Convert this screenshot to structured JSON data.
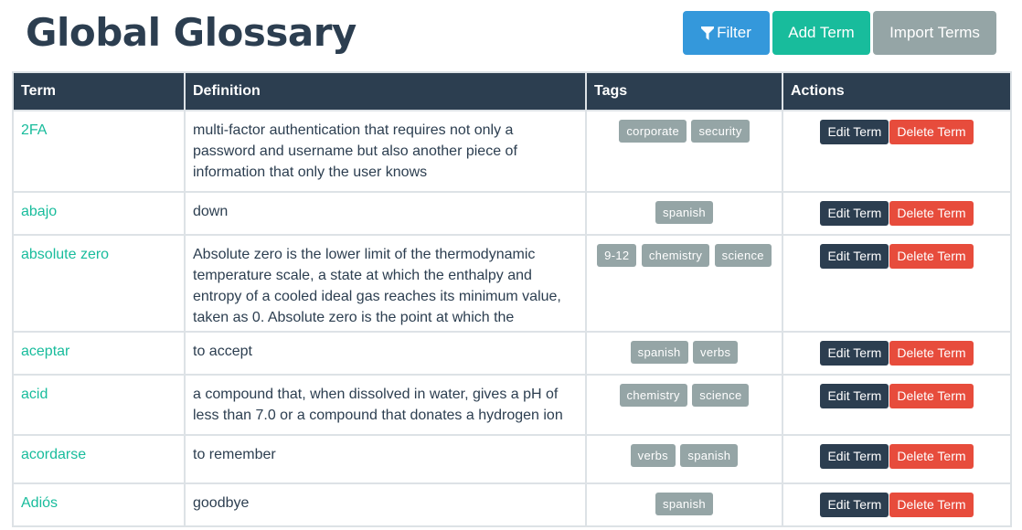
{
  "header": {
    "title": "Global Glossary",
    "buttons": {
      "filter": "Filter",
      "add": "Add Term",
      "import": "Import Terms"
    }
  },
  "table": {
    "columns": [
      "Term",
      "Definition",
      "Tags",
      "Actions"
    ],
    "action_labels": {
      "edit": "Edit Term",
      "delete": "Delete Term"
    },
    "rows": [
      {
        "term": "2FA",
        "definition": "multi-factor authentication that requires not only a password and username but also another piece of information that only the user knows",
        "tags": [
          "corporate",
          "security"
        ]
      },
      {
        "term": "abajo",
        "definition": "down",
        "tags": [
          "spanish"
        ]
      },
      {
        "term": "absolute zero",
        "definition": "Absolute zero is the lower limit of the thermodynamic temperature scale, a state at which the enthalpy and entropy of a cooled ideal gas reaches its minimum value, taken as 0. Absolute zero is the point at which the",
        "tags": [
          "9-12",
          "chemistry",
          "science"
        ]
      },
      {
        "term": "aceptar",
        "definition": "to accept",
        "tags": [
          "spanish",
          "verbs"
        ]
      },
      {
        "term": "acid",
        "definition": "a compound that, when dissolved in water, gives a pH of less than 7.0 or a compound that donates a hydrogen ion",
        "tags": [
          "chemistry",
          "science"
        ]
      },
      {
        "term": "acordarse",
        "definition": "to remember",
        "tags": [
          "verbs",
          "spanish"
        ]
      },
      {
        "term": "Adiós",
        "definition": "goodbye",
        "tags": [
          "spanish"
        ]
      }
    ]
  },
  "colors": {
    "primary": "#2c3e50",
    "info": "#3498db",
    "success": "#18bc9c",
    "muted": "#95a5a6",
    "danger": "#e74c3c"
  },
  "icons": {
    "filter": "filter-icon"
  }
}
